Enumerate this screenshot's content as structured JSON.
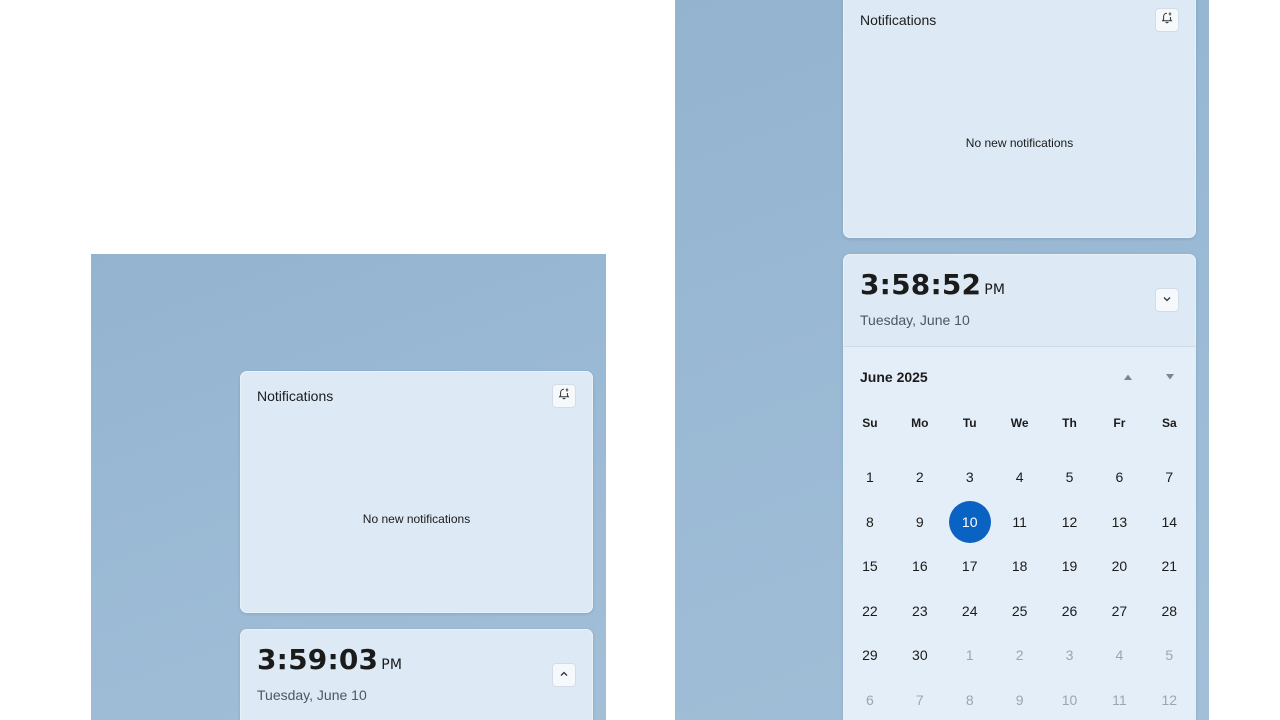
{
  "left": {
    "notifications": {
      "title": "Notifications",
      "empty_text": "No new notifications",
      "settings_icon": "notification-settings-icon"
    },
    "clock": {
      "time": "3:59:03",
      "ampm": "PM",
      "date": "Tuesday, June 10",
      "toggle_icon": "chevron-up-icon"
    }
  },
  "right": {
    "notifications": {
      "title": "Notifications",
      "empty_text": "No new notifications",
      "settings_icon": "notification-settings-icon"
    },
    "clock": {
      "time": "3:58:52",
      "ampm": "PM",
      "date": "Tuesday, June 10",
      "toggle_icon": "chevron-down-icon"
    },
    "calendar": {
      "month_label": "June 2025",
      "prev_icon": "triangle-up-icon",
      "next_icon": "triangle-down-icon",
      "weekdays": [
        "Su",
        "Mo",
        "Tu",
        "We",
        "Th",
        "Fr",
        "Sa"
      ],
      "selected_day": "10",
      "weeks": [
        [
          {
            "d": "1"
          },
          {
            "d": "2"
          },
          {
            "d": "3"
          },
          {
            "d": "4"
          },
          {
            "d": "5"
          },
          {
            "d": "6"
          },
          {
            "d": "7"
          }
        ],
        [
          {
            "d": "8"
          },
          {
            "d": "9"
          },
          {
            "d": "10",
            "today": true
          },
          {
            "d": "11"
          },
          {
            "d": "12"
          },
          {
            "d": "13"
          },
          {
            "d": "14"
          }
        ],
        [
          {
            "d": "15"
          },
          {
            "d": "16"
          },
          {
            "d": "17"
          },
          {
            "d": "18"
          },
          {
            "d": "19"
          },
          {
            "d": "20"
          },
          {
            "d": "21"
          }
        ],
        [
          {
            "d": "22"
          },
          {
            "d": "23"
          },
          {
            "d": "24"
          },
          {
            "d": "25"
          },
          {
            "d": "26"
          },
          {
            "d": "27"
          },
          {
            "d": "28"
          }
        ],
        [
          {
            "d": "29"
          },
          {
            "d": "30"
          },
          {
            "d": "1",
            "other": true
          },
          {
            "d": "2",
            "other": true
          },
          {
            "d": "3",
            "other": true
          },
          {
            "d": "4",
            "other": true
          },
          {
            "d": "5",
            "other": true
          }
        ],
        [
          {
            "d": "6",
            "other": true
          },
          {
            "d": "7",
            "other": true
          },
          {
            "d": "8",
            "other": true
          },
          {
            "d": "9",
            "other": true
          },
          {
            "d": "10",
            "other": true
          },
          {
            "d": "11",
            "other": true
          },
          {
            "d": "12",
            "other": true
          }
        ]
      ]
    }
  },
  "colors": {
    "accent": "#0a63c2",
    "panel": "#ddeaf5",
    "wallpaper": "#97b6d1"
  }
}
